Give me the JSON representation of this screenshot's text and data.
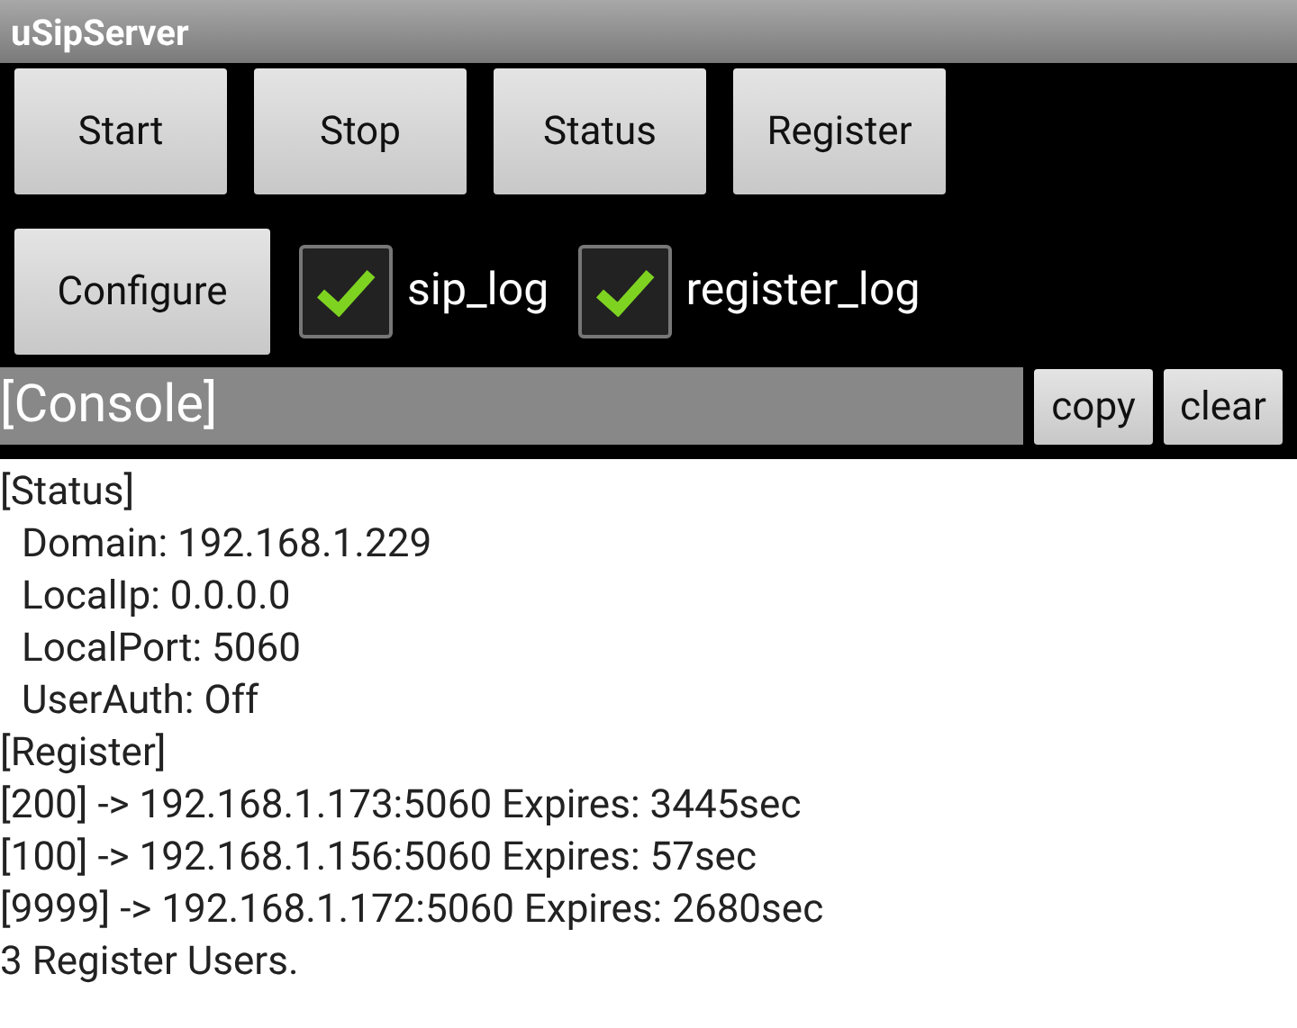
{
  "window": {
    "title": "uSipServer"
  },
  "buttons": [
    "Start",
    "Stop",
    "Status",
    "Register"
  ],
  "configure_button": "Configure",
  "checkboxes": [
    {
      "label": "sip_log",
      "checked": true
    },
    {
      "label": "register_log",
      "checked": true
    }
  ],
  "console": {
    "title": "[Console]",
    "buttons": [
      "copy",
      "clear"
    ],
    "lines": [
      {
        "kind": "plain",
        "text": "[Status]"
      },
      {
        "kind": "indented",
        "text": "Domain: 192.168.1.229"
      },
      {
        "kind": "indented",
        "text": "LocalIp: 0.0.0.0"
      },
      {
        "kind": "indented",
        "text": "LocalPort: 5060"
      },
      {
        "kind": "indented",
        "text": "UserAuth: Off"
      },
      {
        "kind": "plain",
        "text": "[Register]"
      },
      {
        "kind": "plain",
        "text": "[200] -> 192.168.1.173:5060 Expires: 3445sec"
      },
      {
        "kind": "plain",
        "text": "[100] -> 192.168.1.156:5060 Expires: 57sec"
      },
      {
        "kind": "plain",
        "text": "[9999] -> 192.168.1.172:5060 Expires: 2680sec"
      },
      {
        "kind": "plain",
        "text": "3 Register Users."
      }
    ]
  }
}
